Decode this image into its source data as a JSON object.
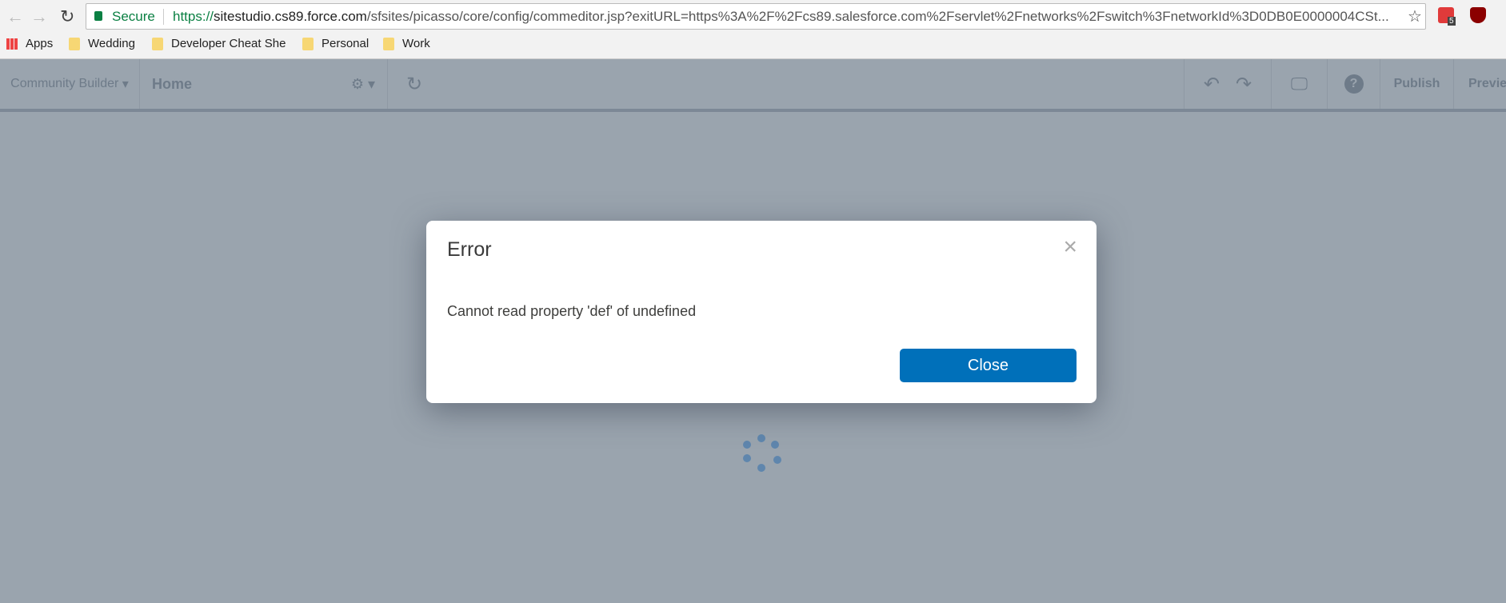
{
  "browser": {
    "secure_label": "Secure",
    "url_scheme": "https://",
    "url_host": "sitestudio.cs89.force.com",
    "url_path": "/sfsites/picasso/core/config/commeditor.jsp?exitURL=https%3A%2F%2Fcs89.salesforce.com%2Fservlet%2Fnetworks%2Fswitch%3FnetworkId%3D0DB0E0000004CSt...",
    "extension_badge": "5",
    "bookmarks": [
      {
        "label": "Apps",
        "icon": "apps-grid-icon"
      },
      {
        "label": "Wedding",
        "icon": "folder-icon"
      },
      {
        "label": "Developer Cheat She",
        "icon": "folder-icon"
      },
      {
        "label": "Personal",
        "icon": "folder-icon"
      },
      {
        "label": "Work",
        "icon": "folder-icon"
      }
    ]
  },
  "app": {
    "builder_label": "Community Builder",
    "page_label": "Home",
    "publish_label": "Publish",
    "preview_label": "Previe"
  },
  "modal": {
    "title": "Error",
    "message": "Cannot read property 'def' of undefined",
    "close_label": "Close",
    "close_icon": "×"
  },
  "colors": {
    "accent": "#0070ba",
    "backdrop": "#9aa4ae"
  }
}
